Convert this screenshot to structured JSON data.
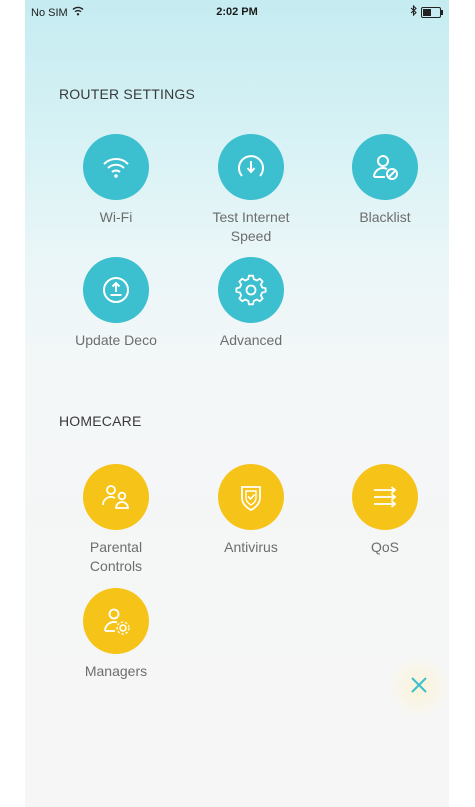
{
  "status_bar": {
    "carrier": "No SIM",
    "time": "2:02 PM",
    "battery_level": 0.5
  },
  "router_settings": {
    "title": "ROUTER SETTINGS",
    "items": [
      {
        "label_line1": "Wi-Fi",
        "label_line2": "",
        "icon": "wifi-icon"
      },
      {
        "label_line1": "Test Internet",
        "label_line2": "Speed",
        "icon": "speedometer-icon"
      },
      {
        "label_line1": "Blacklist",
        "label_line2": "",
        "icon": "blacklist-user-icon"
      },
      {
        "label_line1": "Update Deco",
        "label_line2": "",
        "icon": "upload-icon"
      },
      {
        "label_line1": "Advanced",
        "label_line2": "",
        "icon": "gear-icon"
      }
    ]
  },
  "homecare": {
    "title": "HOMECARE",
    "items": [
      {
        "label_line1": "Parental",
        "label_line2": "Controls",
        "icon": "parental-icon"
      },
      {
        "label_line1": "Antivirus",
        "label_line2": "",
        "icon": "shield-icon"
      },
      {
        "label_line1": "QoS",
        "label_line2": "",
        "icon": "qos-arrows-icon"
      },
      {
        "label_line1": "Managers",
        "label_line2": "",
        "icon": "manager-icon"
      }
    ]
  },
  "colors": {
    "teal": "#3cbfce",
    "yellow": "#f6c419",
    "close": "#3cbfce"
  }
}
